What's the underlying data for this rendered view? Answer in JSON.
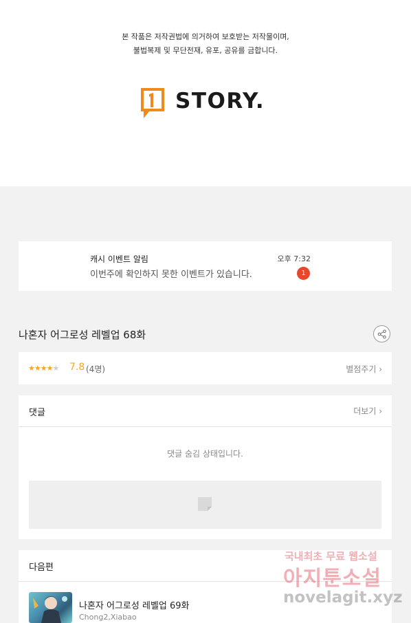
{
  "header": {
    "copyright_line1": "본 작품은 저작권법에 의거하여 보호받는 저작물이며,",
    "copyright_line2": "불법복제 및 무단전재, 유포, 공유를 금합니다.",
    "logo_badge": "1",
    "logo_text": "STORY."
  },
  "notification": {
    "title": "캐시 이벤트 알림",
    "body": "이번주에 확인하지 못한 이벤트가 있습니다.",
    "time": "오후 7:32",
    "badge_count": "1"
  },
  "episode": {
    "title": "나혼자 어그로성 레벨업 68화",
    "share_icon": "share-icon"
  },
  "rating": {
    "stars_filled": "★★★★",
    "stars_empty": "★",
    "star_value": 4,
    "star_max": 5,
    "score": "7.8",
    "count": "(4명)",
    "rate_link": "별점주기 ›"
  },
  "comments": {
    "heading": "댓글",
    "more_link": "더보기 ›",
    "hidden_message": "댓글 숨김 상태입니다."
  },
  "next": {
    "heading": "다음편",
    "item": {
      "title": "나혼자 어그로성 레벨업 69화",
      "author": "Chong2,Xiabao"
    }
  },
  "watermark": {
    "line1": "국내최초 무료 웹소설",
    "line2": "아지툰소설",
    "line3": "novelagit.xyz"
  },
  "colors": {
    "accent_orange": "#f5a623",
    "badge_red": "#e8472b",
    "logo_orange": "#f08a1c"
  }
}
